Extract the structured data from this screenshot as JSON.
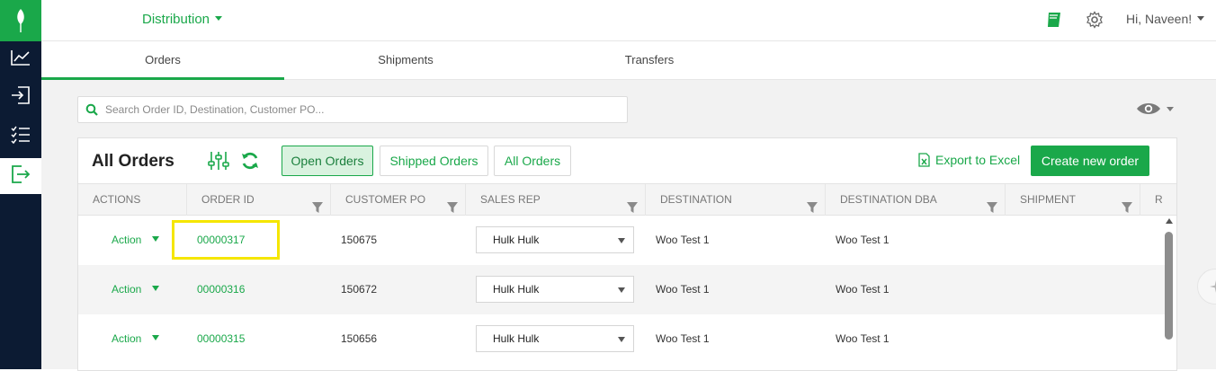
{
  "app": {
    "module_name": "Distribution",
    "user_greeting": "Hi, Naveen!"
  },
  "colors": {
    "brand_green": "#1aa84a",
    "sidebar_navy": "#0c1b33",
    "highlight_yellow": "#f5e600"
  },
  "sidebar": {
    "items": [
      {
        "icon": "line-chart-icon",
        "active": false
      },
      {
        "icon": "sign-in-icon",
        "active": false
      },
      {
        "icon": "checklist-icon",
        "active": false
      },
      {
        "icon": "sign-out-icon",
        "active": true
      }
    ]
  },
  "tabs": [
    {
      "label": "Orders",
      "active": true
    },
    {
      "label": "Shipments",
      "active": false
    },
    {
      "label": "Transfers",
      "active": false
    }
  ],
  "search": {
    "placeholder": "Search Order ID, Destination, Customer PO..."
  },
  "panel": {
    "title": "All Orders",
    "filters": [
      {
        "label": "Open Orders",
        "active": true
      },
      {
        "label": "Shipped Orders",
        "active": false
      },
      {
        "label": "All Orders",
        "active": false
      }
    ],
    "export_label": "Export to Excel",
    "create_label": "Create new order"
  },
  "table": {
    "columns": [
      "Actions",
      "Order ID",
      "Customer PO",
      "Sales Rep",
      "Destination",
      "Destination DBA",
      "Shipment",
      "R"
    ],
    "rows": [
      {
        "action": "Action",
        "order_id": "00000317",
        "customer_po": "150675",
        "sales_rep": "Hulk Hulk",
        "destination": "Woo Test 1",
        "destination_dba": "Woo Test 1",
        "shipment": ""
      },
      {
        "action": "Action",
        "order_id": "00000316",
        "customer_po": "150672",
        "sales_rep": "Hulk Hulk",
        "destination": "Woo Test 1",
        "destination_dba": "Woo Test 1",
        "shipment": ""
      },
      {
        "action": "Action",
        "order_id": "00000315",
        "customer_po": "150656",
        "sales_rep": "Hulk Hulk",
        "destination": "Woo Test 1",
        "destination_dba": "Woo Test 1",
        "shipment": ""
      }
    ]
  }
}
